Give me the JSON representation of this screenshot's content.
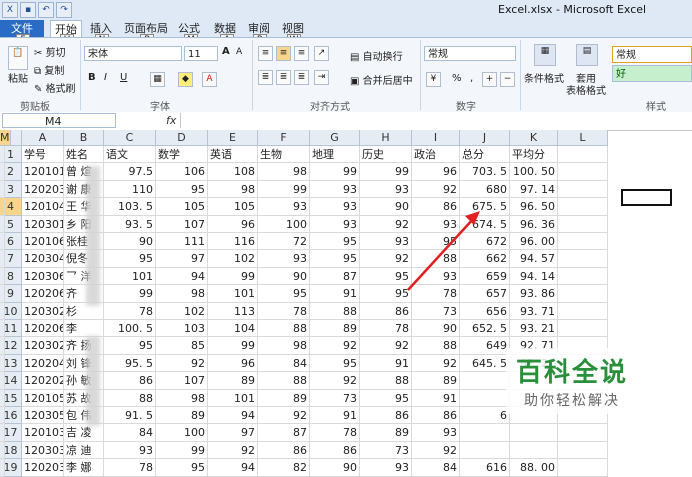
{
  "window": {
    "title": "Excel.xlsx - Microsoft Excel"
  },
  "qat_keytips": [
    "1",
    "2",
    "3"
  ],
  "tabs": [
    {
      "label": "文件",
      "key": "F"
    },
    {
      "label": "开始",
      "key": "H"
    },
    {
      "label": "插入",
      "key": "N"
    },
    {
      "label": "页面布局",
      "key": "P"
    },
    {
      "label": "公式",
      "key": "M"
    },
    {
      "label": "数据",
      "key": "A"
    },
    {
      "label": "审阅",
      "key": "R"
    },
    {
      "label": "视图",
      "key": "W"
    }
  ],
  "ribbon": {
    "clipboard": {
      "label": "剪贴板",
      "paste": "粘贴",
      "cut": "剪切",
      "copy": "复制",
      "format_painter": "格式刷"
    },
    "font": {
      "label": "字体",
      "name": "宋体",
      "size": "11",
      "bold": "B",
      "italic": "I",
      "underline": "U",
      "grow": "A",
      "shrink": "A"
    },
    "alignment": {
      "label": "对齐方式",
      "wrap": "自动换行",
      "merge": "合并后居中"
    },
    "number": {
      "label": "数字",
      "format": "常规",
      "percent": "%",
      "comma": ","
    },
    "styles": {
      "label": "样式",
      "conditional": "条件格式",
      "table_format_1": "套用",
      "table_format_2": "表格格式",
      "normal": "常规",
      "good": "好"
    }
  },
  "formula_bar": {
    "name_box": "M4",
    "fx": "fx",
    "value": ""
  },
  "columns": [
    "A",
    "B",
    "C",
    "D",
    "E",
    "F",
    "G",
    "H",
    "I",
    "J",
    "K",
    "L",
    "M"
  ],
  "selected_column": "M",
  "selected_row": "4",
  "row_numbers": [
    "1",
    "2",
    "3",
    "4",
    "5",
    "6",
    "7",
    "8",
    "9",
    "10",
    "11",
    "12",
    "13",
    "14",
    "15",
    "16",
    "17",
    "18",
    "19"
  ],
  "header_row": [
    "学号",
    "姓名",
    "语文",
    "数学",
    "英语",
    "生物",
    "地理",
    "历史",
    "政治",
    "总分",
    "平均分"
  ],
  "rows": [
    [
      "120101",
      "曾 煊",
      "97.5",
      "106",
      "108",
      "98",
      "99",
      "99",
      "96",
      "703. 5",
      "100. 50"
    ],
    [
      "120203",
      "谢 康",
      "110",
      "95",
      "98",
      "99",
      "93",
      "93",
      "92",
      "680",
      "97. 14"
    ],
    [
      "120104",
      "王 华",
      "103. 5",
      "105",
      "105",
      "93",
      "93",
      "90",
      "86",
      "675. 5",
      "96. 50"
    ],
    [
      "120301",
      "乡 阳",
      "93. 5",
      "107",
      "96",
      "100",
      "93",
      "92",
      "93",
      "674. 5",
      "96. 36"
    ],
    [
      "120106",
      "张桂 ",
      "90",
      "111",
      "116",
      "72",
      "95",
      "93",
      "95",
      "672",
      "96. 00"
    ],
    [
      "120304",
      "倪冬 ",
      "95",
      "97",
      "102",
      "93",
      "95",
      "92",
      "88",
      "662",
      "94. 57"
    ],
    [
      "120306",
      "乛 洋",
      "101",
      "94",
      "99",
      "90",
      "87",
      "95",
      "93",
      "659",
      "94. 14"
    ],
    [
      "120206",
      "齐 ",
      "99",
      "98",
      "101",
      "95",
      "91",
      "95",
      "78",
      "657",
      "93. 86"
    ],
    [
      "120302",
      "杉 ",
      "78",
      "102",
      "113",
      "78",
      "88",
      "86",
      "73",
      "656",
      "93. 71"
    ],
    [
      "120206",
      "李 ",
      "100. 5",
      "103",
      "104",
      "88",
      "89",
      "78",
      "90",
      "652. 5",
      "93. 21"
    ],
    [
      "120302",
      "齐 扬",
      "95",
      "85",
      "99",
      "98",
      "92",
      "92",
      "88",
      "649",
      "92. 71"
    ],
    [
      "120204",
      "刘 锋",
      "95. 5",
      "92",
      "96",
      "84",
      "95",
      "91",
      "92",
      "645. 5",
      "92. 21"
    ],
    [
      "120202",
      "孙 敏",
      "86",
      "107",
      "89",
      "88",
      "92",
      "88",
      "89",
      "",
      ""
    ],
    [
      "120105",
      "苏 故",
      "88",
      "98",
      "101",
      "89",
      "73",
      "95",
      "91",
      "",
      ""
    ],
    [
      "120305",
      "包 伟",
      "91. 5",
      "89",
      "94",
      "92",
      "91",
      "86",
      "86",
      "6",
      ""
    ],
    [
      "120103",
      "吉 凌",
      "84",
      "100",
      "97",
      "87",
      "78",
      "89",
      "93",
      "",
      ""
    ],
    [
      "120303",
      "凉 迪",
      "93",
      "99",
      "92",
      "86",
      "86",
      "73",
      "92",
      "",
      ""
    ],
    [
      "120203",
      "李 娜",
      "78",
      "95",
      "94",
      "82",
      "90",
      "93",
      "84",
      "616",
      "88. 00"
    ]
  ],
  "watermark": {
    "logo": "百科全说",
    "sub": "助你轻松解决"
  },
  "colors": {
    "file_tab": "#2a6cc5",
    "watermark_green": "#2a8f3a",
    "arrow": "#e02020",
    "selected_header": "#f8d58a"
  }
}
